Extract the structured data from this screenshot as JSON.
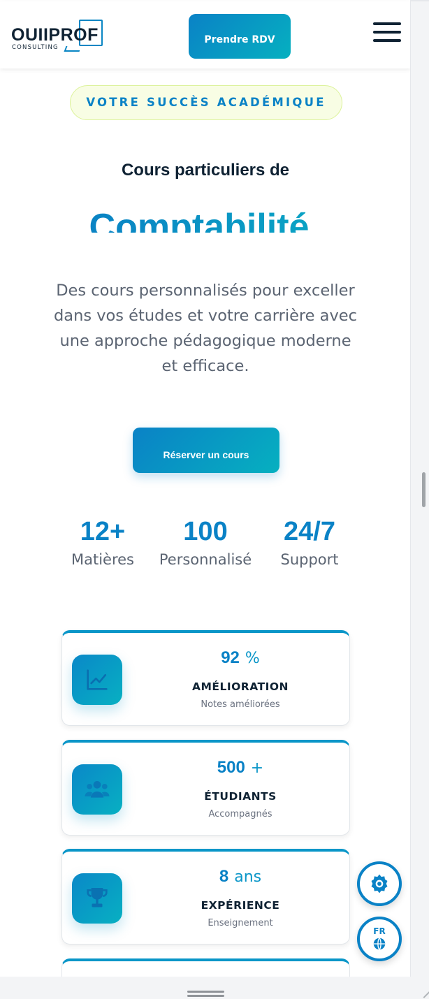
{
  "header": {
    "logo_main": "OUIIPROF",
    "logo_sub": "CONSULTING",
    "cta_label": "Prendre RDV",
    "menu_icon": "hamburger-menu-icon"
  },
  "hero": {
    "badge": "VOTRE SUCCÈS ACADÉMIQUE",
    "subtitle": "Cours particuliers de",
    "subject": "Comptabilité",
    "description": "Des cours personnalisés pour exceller dans vos études et votre carrière avec une approche pédagogique moderne et efficace.",
    "cta_label": "Réserver un cours"
  },
  "stats": [
    {
      "value": "12+",
      "label": "Matières"
    },
    {
      "value": "100",
      "label": "Personnalisé"
    },
    {
      "value": "24/7",
      "label": "Support"
    }
  ],
  "cards": [
    {
      "value": "92",
      "unit": "%",
      "title": "AMÉLIORATION",
      "subtitle": "Notes améliorées",
      "icon": "chart-line-icon"
    },
    {
      "value": "500",
      "unit": "+",
      "title": "ÉTUDIANTS",
      "subtitle": "Accompagnés",
      "icon": "users-icon"
    },
    {
      "value": "8",
      "unit": "ans",
      "title": "EXPÉRIENCE",
      "subtitle": "Enseignement",
      "icon": "trophy-icon"
    }
  ],
  "floating": {
    "settings_icon": "gear-icon",
    "language_code": "FR",
    "language_icon": "globe-icon"
  },
  "colors": {
    "accent": "#0a82c6",
    "accent_teal": "#06b0c0",
    "navy": "#0f2233",
    "badge_bg": "#f8fde4"
  }
}
